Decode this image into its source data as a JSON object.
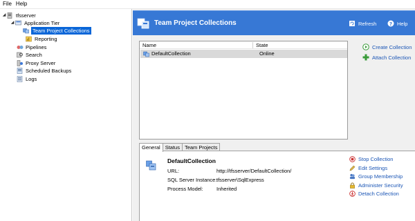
{
  "menu": {
    "file": "File",
    "help": "Help"
  },
  "tree": {
    "server": "tfsserver",
    "app_tier": "Application Tier",
    "team_project_collections": "Team Project Collections",
    "reporting": "Reporting",
    "pipelines": "Pipelines",
    "search": "Search",
    "proxy_server": "Proxy Server",
    "scheduled_backups": "Scheduled Backups",
    "logs": "Logs"
  },
  "header": {
    "title": "Team Project Collections",
    "refresh": "Refresh",
    "help": "Help",
    "color": "#3778d5"
  },
  "list": {
    "col_name": "Name",
    "col_state": "State",
    "rows": [
      {
        "name": "DefaultCollection",
        "state": "Online"
      }
    ]
  },
  "side_actions": {
    "create": "Create Collection",
    "attach": "Attach Collection"
  },
  "tabs": [
    "General",
    "Status",
    "Team Projects"
  ],
  "detail": {
    "title": "DefaultCollection",
    "url_label": "URL:",
    "url_value": "http://tfsserver/DefaultCollection/",
    "sql_label": "SQL Server Instance:",
    "sql_value": "tfsserver\\SqlExpress",
    "process_label": "Process Model:",
    "process_value": "Inherited"
  },
  "detail_actions": {
    "stop": "Stop Collection",
    "edit": "Edit Settings",
    "group": "Group Membership",
    "security": "Administer Security",
    "detach": "Detach Collection"
  }
}
